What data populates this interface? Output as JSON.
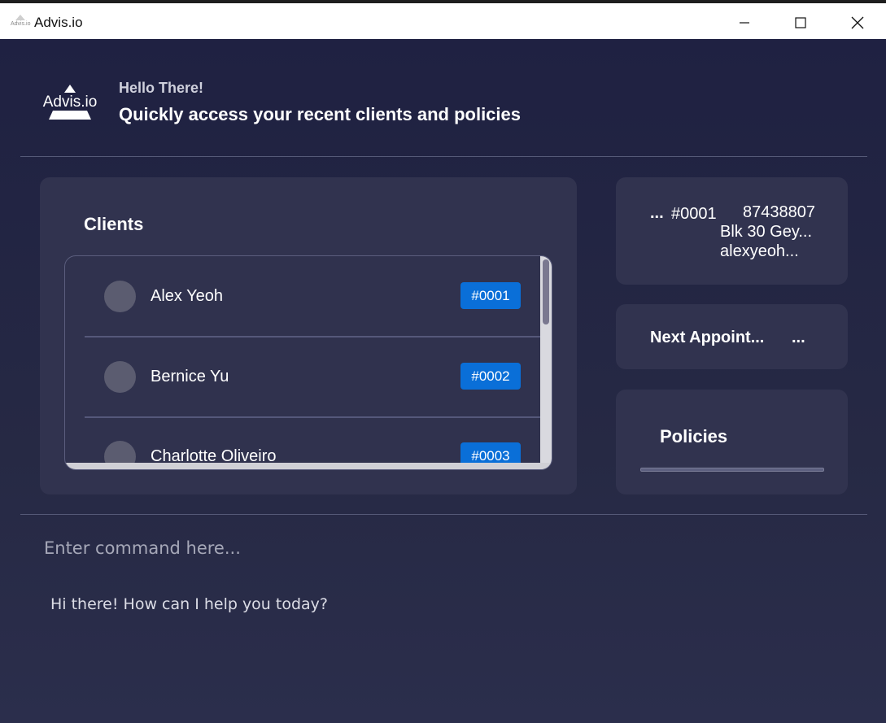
{
  "window": {
    "title": "Advis.io",
    "icon_label": "Advis.io"
  },
  "header": {
    "logo_text": "Advis.io",
    "greeting": "Hello There!",
    "subtitle": "Quickly access your recent clients and policies"
  },
  "clients": {
    "title": "Clients",
    "items": [
      {
        "name": "Alex Yeoh",
        "id": "#0001"
      },
      {
        "name": "Bernice Yu",
        "id": "#0002"
      },
      {
        "name": "Charlotte Oliveiro",
        "id": "#0003"
      }
    ]
  },
  "client_summary": {
    "prefix": "...",
    "id": "#0001",
    "phone": "87438807",
    "address": "Blk 30 Gey...",
    "email": "alexyeoh..."
  },
  "appointment": {
    "title": "Next Appoint...",
    "value": "..."
  },
  "policies": {
    "title": "Policies"
  },
  "command": {
    "placeholder": "Enter command here...",
    "value": ""
  },
  "response": {
    "text": "Hi there! How can I help you today?"
  },
  "colors": {
    "background": "#22243f",
    "panel": "#31334f",
    "badge": "#0a6fd8"
  },
  "icons": {
    "minimize": "minimize-icon",
    "maximize": "maximize-icon",
    "close": "close-icon"
  }
}
